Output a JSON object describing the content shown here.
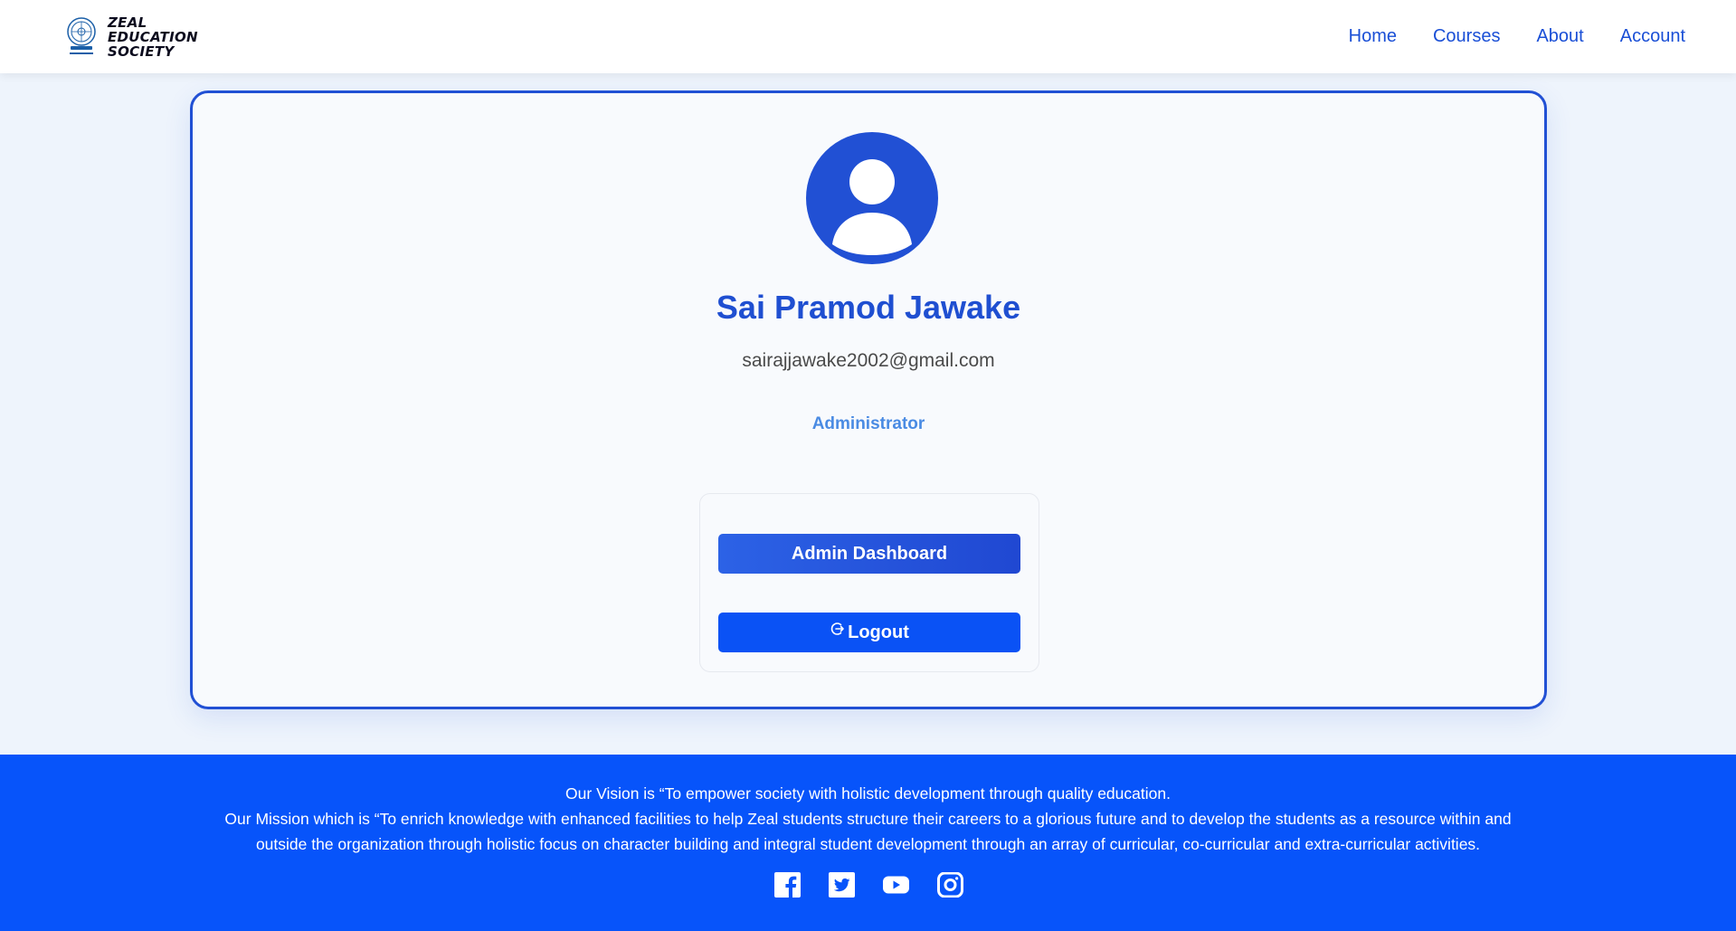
{
  "brand": {
    "lines": [
      "ZEAL",
      "EDUCATION",
      "SOCIETY"
    ],
    "logo_icon": "zeal-seal-logo"
  },
  "nav": {
    "items": [
      "Home",
      "Courses",
      "About",
      "Account"
    ]
  },
  "profile": {
    "avatar_icon": "user-avatar-icon",
    "name": "Sai Pramod Jawake",
    "email": "sairajjawake2002@gmail.com",
    "role": "Administrator"
  },
  "actions": {
    "dashboard_label": "Admin Dashboard",
    "logout_label": "Logout",
    "logout_icon": "logout-icon"
  },
  "footer": {
    "vision": "Our Vision is “To empower society with holistic development through quality education.",
    "mission": "Our Mission which is “To enrich knowledge with enhanced facilities to help Zeal students structure their careers to a glorious future and to develop the students as a resource within and outside the organization through holistic focus on character building and integral student development through an array of curricular, co-curricular and extra-curricular activities.",
    "socials": [
      "facebook-icon",
      "twitter-icon",
      "youtube-icon",
      "instagram-icon"
    ]
  },
  "colors": {
    "primary": "#1f4fd1",
    "footer_bg": "#0754fa",
    "role_text": "#4a8be3",
    "page_bg": "#eef4fc"
  }
}
